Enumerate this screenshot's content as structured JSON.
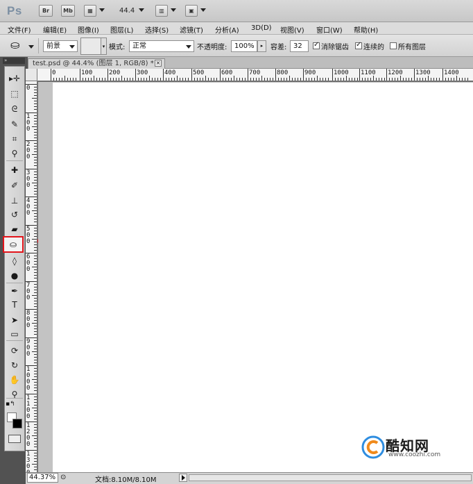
{
  "appbar": {
    "logo": "Ps",
    "bridge_btn": "Br",
    "minibridge_btn": "Mb",
    "zoom": "44.4"
  },
  "menu": [
    {
      "label": "文件(F)"
    },
    {
      "label": "编辑(E)"
    },
    {
      "label": "图像(I)"
    },
    {
      "label": "图层(L)"
    },
    {
      "label": "选择(S)"
    },
    {
      "label": "滤镜(T)"
    },
    {
      "label": "分析(A)"
    },
    {
      "label": "3D(D)"
    },
    {
      "label": "视图(V)"
    },
    {
      "label": "窗口(W)"
    },
    {
      "label": "帮助(H)"
    }
  ],
  "options": {
    "fill_source": "前景",
    "mode_label": "模式:",
    "mode_value": "正常",
    "opacity_label": "不透明度:",
    "opacity_value": "100%",
    "tolerance_label": "容差:",
    "tolerance_value": "32",
    "antialias_label": "消除锯齿",
    "antialias_checked": true,
    "contiguous_label": "连续的",
    "contiguous_checked": true,
    "all_layers_label": "所有图层",
    "all_layers_checked": false
  },
  "panel": {
    "collapse": "»"
  },
  "document": {
    "tab_title": "test.psd @ 44.4% (图层 1, RGB/8) *",
    "close": "×"
  },
  "ruler": {
    "top_labels": [
      "0",
      "100",
      "200",
      "300",
      "400",
      "500",
      "600",
      "700",
      "800",
      "900",
      "1000",
      "1100",
      "1200",
      "1300",
      "1400"
    ],
    "left_labels": [
      "0",
      "1\n0\n0",
      "2\n0\n0",
      "3\n0\n0",
      "4\n0\n0",
      "5\n0\n0",
      "6\n0\n0",
      "7\n0\n0",
      "8\n0\n0",
      "9\n0\n0",
      "1\n0\n0\n0",
      "1\n1\n0\n0",
      "1\n2\n0\n0",
      "1\n3\n0\n0"
    ]
  },
  "tools": [
    {
      "name": "move-tool",
      "glyph": "▸✛"
    },
    {
      "name": "marquee-tool",
      "glyph": "⬚"
    },
    {
      "name": "lasso-tool",
      "glyph": "ᘓ"
    },
    {
      "name": "quick-selection-tool",
      "glyph": "✎"
    },
    {
      "name": "crop-tool",
      "glyph": "⌗"
    },
    {
      "name": "eyedropper-tool",
      "glyph": "⚲"
    },
    {
      "name": "healing-brush-tool",
      "glyph": "✚"
    },
    {
      "name": "brush-tool",
      "glyph": "✐"
    },
    {
      "name": "clone-stamp-tool",
      "glyph": "⊥"
    },
    {
      "name": "history-brush-tool",
      "glyph": "↺"
    },
    {
      "name": "eraser-tool",
      "glyph": "▰"
    },
    {
      "name": "paint-bucket-tool",
      "glyph": "⛀"
    },
    {
      "name": "blur-tool",
      "glyph": "◊"
    },
    {
      "name": "dodge-tool",
      "glyph": "●"
    },
    {
      "name": "pen-tool",
      "glyph": "✒"
    },
    {
      "name": "type-tool",
      "glyph": "T"
    },
    {
      "name": "path-selection-tool",
      "glyph": "➤"
    },
    {
      "name": "shape-tool",
      "glyph": "▭"
    },
    {
      "name": "3d-rotate-tool",
      "glyph": "⟳"
    },
    {
      "name": "3d-orbit-tool",
      "glyph": "↻"
    },
    {
      "name": "hand-tool",
      "glyph": "✋"
    },
    {
      "name": "zoom-tool",
      "glyph": "⚲"
    }
  ],
  "status": {
    "zoom": "44.37%",
    "doc_info": "文档:8.10M/8.10M"
  },
  "watermark": {
    "name": "酷知网",
    "url": "www.coozhi.com"
  },
  "colors": {
    "highlight": "#e3141b",
    "canvas": "#ffffff"
  }
}
